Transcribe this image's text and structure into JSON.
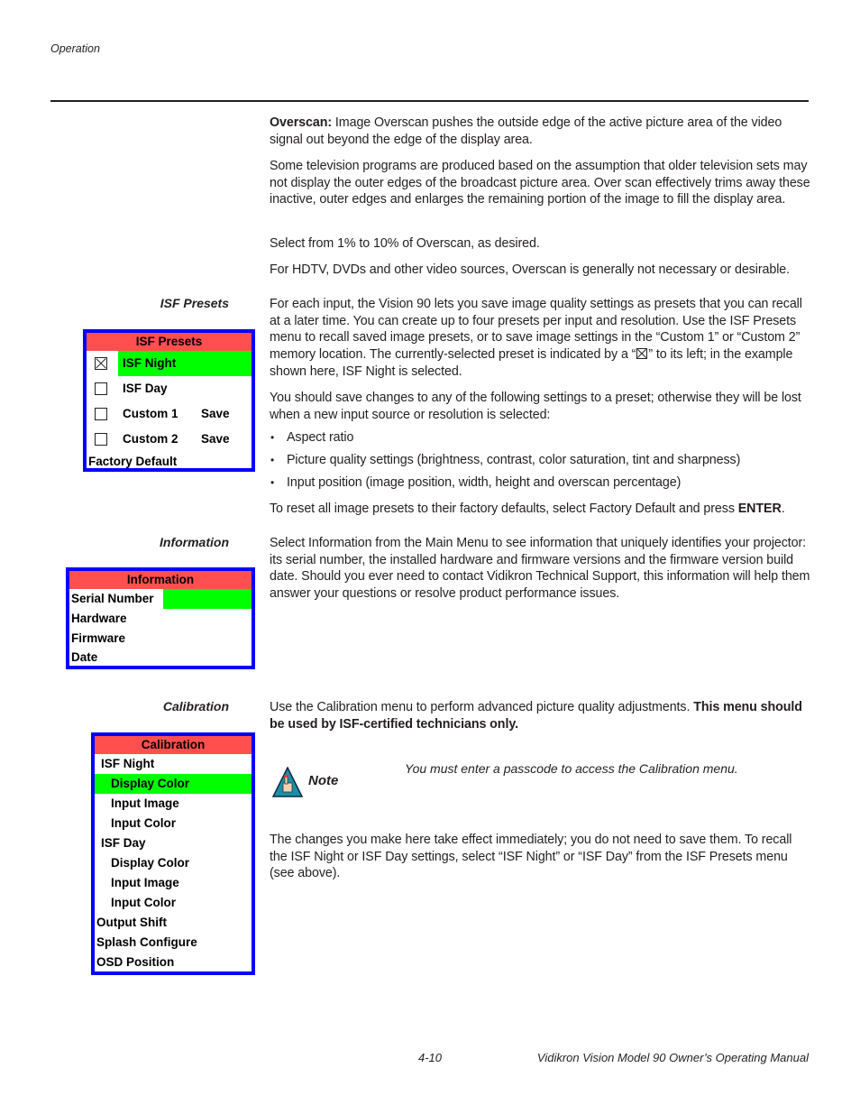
{
  "header": {
    "section": "Operation"
  },
  "overscan": {
    "term": "Overscan:",
    "definition": "Image Overscan pushes the outside edge of the active picture area of the video signal out beyond the edge of the display area.",
    "para2": "Some television programs are produced based on the assumption that older television sets may not display the outer edges of the broadcast picture area. Over scan effectively trims away these inactive, outer edges and enlarges the remaining portion of the image to fill the display area.",
    "para3": "Select from 1% to 10% of Overscan, as desired.",
    "para4": "For HDTV, DVDs and other video sources, Overscan is generally not necessary or desirable."
  },
  "isf_presets": {
    "side_label": "ISF Presets",
    "para1_a": "For each input, the Vision 90 lets you save image quality settings as presets that you can recall at a later time. You can create up to four presets per input and resolution. Use the ISF Presets menu to recall saved image presets, or to save image settings in the “Custom 1” or “Custom 2” memory location. The currently-selected preset is indicated by a “",
    "para1_b": "” to its left; in the example shown here, ISF Night is selected.",
    "para2": "You should save changes to any of the following settings to a preset; otherwise they will be lost when a new input source or resolution is selected:",
    "bullets": [
      "Aspect ratio",
      "Picture quality settings (brightness, contrast, color saturation, tint and sharpness)",
      "Input position (image position, width, height and overscan percentage)"
    ],
    "reset_a": "To reset all image presets to their factory defaults, select Factory Default and press ",
    "reset_key": "ENTER",
    "reset_b": ".",
    "menu": {
      "title": "ISF Presets",
      "items": [
        {
          "label": "ISF Night",
          "checked": true,
          "action": ""
        },
        {
          "label": "ISF Day",
          "checked": false,
          "action": ""
        },
        {
          "label": "Custom 1",
          "checked": false,
          "action": "Save"
        },
        {
          "label": "Custom 2",
          "checked": false,
          "action": "Save"
        }
      ],
      "footer_item": "Factory Default"
    }
  },
  "information": {
    "side_label": "Information",
    "para": "Select Information from the Main Menu to see information that uniquely identifies your projector: its serial number, the installed hardware and firmware versions and the firmware version build date. Should you ever need to contact Vidikron Technical Support, this information will help them answer your questions or resolve product performance issues.",
    "menu": {
      "title": "Information",
      "items": [
        "Serial Number",
        "Hardware",
        "Firmware",
        "Date"
      ]
    }
  },
  "calibration": {
    "side_label": "Calibration",
    "para1": "Use the Calibration menu to perform advanced picture quality adjustments. ",
    "para1_bold": "This menu should be used by ISF-certified technicians only.",
    "note_label": "Note",
    "note_text": "You must enter a passcode to access the Calibration menu.",
    "para2": "The changes you make here take effect immediately; you do not need to save them. To recall the ISF Night or ISF Day settings, select “ISF Night” or “ISF Day” from the ISF Presets menu (see above).",
    "menu": {
      "title": "Calibration",
      "items": [
        "ISF Night",
        "Display Color",
        "Input Image",
        "Input Color",
        "ISF Day",
        "Display Color",
        "Input Image",
        "Input Color",
        "Output Shift",
        "Splash Configure",
        "OSD Position"
      ]
    }
  },
  "footer": {
    "page_number": "4-10",
    "manual_title": "Vidikron Vision Model 90 Owner’s Operating Manual"
  },
  "colors": {
    "menu_border": "#0000ff",
    "menu_title_bg": "#ff4f4f",
    "menu_highlight": "#00ff00"
  }
}
